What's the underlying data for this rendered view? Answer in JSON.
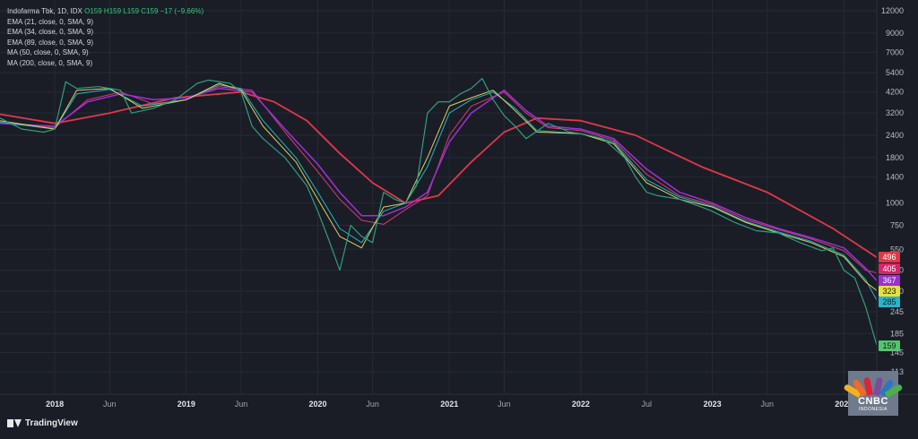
{
  "legend": {
    "ticker": "Indofarma Tbk, 1D, IDX",
    "ohlc": "O159 H159 L159 C159 −17 (−9.66%)",
    "lines": [
      "EMA (21, close, 0, SMA, 9)",
      "EMA (34, close, 0, SMA, 9)",
      "EMA (89, close, 0, SMA, 9)",
      "MA (50, close, 0, SMA, 9)",
      "MA (200, close, 0, SMA, 9)"
    ]
  },
  "branding": {
    "platform": "TradingView",
    "broadcaster": "CNBC",
    "broadcaster_sub": "INDONESIA"
  },
  "colors": {
    "background": "#1a1d26",
    "grid": "#262a35",
    "price": "#2e9e82",
    "ema21": "#d8d25a",
    "ema34": "#25b6c8",
    "ema89": "#a030d6",
    "ma50": "#d63a7a",
    "ma200": "#e03848",
    "last": "#53c56c"
  },
  "chart_data": {
    "type": "line",
    "title": "Indofarma Tbk, 1D, IDX",
    "y_scale": "log",
    "ylim": [
      113,
      12000
    ],
    "y_ticks": [
      12000,
      9000,
      7000,
      5400,
      4200,
      3200,
      2400,
      1800,
      1400,
      1000,
      750,
      550,
      420,
      320,
      245,
      185,
      145,
      113
    ],
    "x_ticks": [
      "2018",
      "Jun",
      "2019",
      "Jun",
      "2020",
      "Jun",
      "2021",
      "Jun",
      "2022",
      "Jul",
      "2023",
      "Jun",
      "2024"
    ],
    "x_tick_dates": [
      "2018-01",
      "2018-06",
      "2019-01",
      "2019-06",
      "2020-01",
      "2020-06",
      "2021-01",
      "2021-06",
      "2022-01",
      "2022-07",
      "2023-01",
      "2023-06",
      "2024-01"
    ],
    "xlim": [
      "2017-08",
      "2024-04"
    ],
    "series": [
      {
        "key": "price",
        "x": [
          "2017-08",
          "2017-10",
          "2017-12",
          "2018-01",
          "2018-02",
          "2018-03",
          "2018-05",
          "2018-07",
          "2018-08",
          "2018-10",
          "2018-12",
          "2019-02",
          "2019-03",
          "2019-05",
          "2019-06",
          "2019-07",
          "2019-08",
          "2019-10",
          "2019-12",
          "2020-01",
          "2020-02",
          "2020-03",
          "2020-04",
          "2020-05",
          "2020-06",
          "2020-07",
          "2020-08",
          "2020-09",
          "2020-10",
          "2020-11",
          "2020-12",
          "2021-01",
          "2021-02",
          "2021-03",
          "2021-04",
          "2021-05",
          "2021-06",
          "2021-07",
          "2021-08",
          "2021-10",
          "2021-12",
          "2022-01",
          "2022-03",
          "2022-05",
          "2022-06",
          "2022-07",
          "2022-08",
          "2022-10",
          "2022-12",
          "2023-01",
          "2023-03",
          "2023-05",
          "2023-07",
          "2023-09",
          "2023-11",
          "2023-12",
          "2024-01",
          "2024-02",
          "2024-03",
          "2024-04"
        ],
        "y": [
          3000,
          2600,
          2500,
          2600,
          4800,
          4400,
          4500,
          4300,
          3200,
          3400,
          3800,
          4700,
          4900,
          4700,
          4200,
          2700,
          2300,
          1800,
          1250,
          900,
          620,
          420,
          750,
          650,
          600,
          1150,
          1050,
          1000,
          1250,
          3200,
          3700,
          3700,
          4100,
          4400,
          5000,
          3800,
          3100,
          2700,
          2300,
          2800,
          2500,
          2450,
          2300,
          1800,
          1400,
          1150,
          1100,
          1050,
          950,
          900,
          780,
          700,
          680,
          600,
          540,
          560,
          420,
          380,
          260,
          159
        ]
      },
      {
        "key": "ema21",
        "x": [
          "2017-08",
          "2018-01",
          "2018-03",
          "2018-06",
          "2018-09",
          "2019-01",
          "2019-04",
          "2019-06",
          "2019-08",
          "2019-11",
          "2020-01",
          "2020-03",
          "2020-05",
          "2020-07",
          "2020-09",
          "2020-11",
          "2021-01",
          "2021-03",
          "2021-05",
          "2021-07",
          "2021-09",
          "2022-01",
          "2022-04",
          "2022-07",
          "2022-10",
          "2023-01",
          "2023-04",
          "2023-07",
          "2023-10",
          "2024-01",
          "2024-03",
          "2024-04"
        ],
        "y": [
          2900,
          2600,
          4300,
          4400,
          3400,
          3800,
          4700,
          4300,
          2700,
          1700,
          1050,
          650,
          560,
          950,
          1000,
          1800,
          3500,
          3900,
          4300,
          3300,
          2500,
          2450,
          2150,
          1300,
          1050,
          950,
          780,
          680,
          600,
          500,
          360,
          323
        ]
      },
      {
        "key": "ema34",
        "x": [
          "2017-08",
          "2018-01",
          "2018-03",
          "2018-06",
          "2018-09",
          "2019-01",
          "2019-04",
          "2019-06",
          "2019-08",
          "2019-11",
          "2020-01",
          "2020-03",
          "2020-05",
          "2020-07",
          "2020-09",
          "2020-11",
          "2021-01",
          "2021-03",
          "2021-05",
          "2021-07",
          "2021-09",
          "2022-01",
          "2022-04",
          "2022-07",
          "2022-10",
          "2023-01",
          "2023-04",
          "2023-07",
          "2023-10",
          "2024-01",
          "2024-03",
          "2024-04"
        ],
        "y": [
          2850,
          2600,
          4100,
          4350,
          3500,
          3800,
          4600,
          4400,
          2900,
          1800,
          1150,
          720,
          600,
          900,
          1000,
          1600,
          3200,
          3800,
          4200,
          3400,
          2550,
          2450,
          2200,
          1350,
          1080,
          960,
          790,
          690,
          610,
          510,
          370,
          285
        ]
      },
      {
        "key": "ema89",
        "x": [
          "2017-08",
          "2018-01",
          "2018-04",
          "2018-07",
          "2018-10",
          "2019-01",
          "2019-04",
          "2019-07",
          "2019-10",
          "2020-01",
          "2020-03",
          "2020-05",
          "2020-07",
          "2020-09",
          "2020-11",
          "2021-01",
          "2021-03",
          "2021-06",
          "2021-08",
          "2021-10",
          "2022-01",
          "2022-04",
          "2022-07",
          "2022-10",
          "2023-01",
          "2023-04",
          "2023-07",
          "2023-10",
          "2024-01",
          "2024-03",
          "2024-04"
        ],
        "y": [
          2800,
          2700,
          3700,
          4100,
          3800,
          3900,
          4400,
          4200,
          2600,
          1650,
          1150,
          850,
          850,
          950,
          1150,
          2200,
          3200,
          4300,
          3300,
          2700,
          2600,
          2300,
          1550,
          1150,
          1000,
          830,
          720,
          640,
          560,
          430,
          367
        ]
      },
      {
        "key": "ma50",
        "x": [
          "2017-08",
          "2018-01",
          "2018-04",
          "2018-07",
          "2018-10",
          "2019-01",
          "2019-04",
          "2019-07",
          "2019-10",
          "2020-01",
          "2020-03",
          "2020-05",
          "2020-07",
          "2020-09",
          "2020-11",
          "2021-01",
          "2021-03",
          "2021-06",
          "2021-08",
          "2021-10",
          "2022-01",
          "2022-04",
          "2022-07",
          "2022-10",
          "2023-01",
          "2023-04",
          "2023-07",
          "2023-10",
          "2024-01",
          "2024-03",
          "2024-04"
        ],
        "y": [
          2800,
          2650,
          3800,
          4200,
          3600,
          3800,
          4500,
          4300,
          2500,
          1500,
          1050,
          800,
          760,
          920,
          1100,
          2400,
          3500,
          4200,
          3200,
          2650,
          2550,
          2250,
          1450,
          1100,
          980,
          810,
          710,
          630,
          540,
          420,
          405
        ]
      },
      {
        "key": "ma200",
        "x": [
          "2017-08",
          "2018-01",
          "2018-06",
          "2018-12",
          "2019-06",
          "2019-09",
          "2019-12",
          "2020-03",
          "2020-06",
          "2020-09",
          "2020-12",
          "2021-03",
          "2021-06",
          "2021-09",
          "2022-01",
          "2022-06",
          "2022-12",
          "2023-06",
          "2023-12",
          "2024-04"
        ],
        "y": [
          3150,
          2800,
          3200,
          3900,
          4200,
          3700,
          2900,
          1900,
          1300,
          1000,
          1100,
          1700,
          2500,
          3000,
          2900,
          2400,
          1600,
          1150,
          720,
          496
        ]
      }
    ],
    "last_value_labels": [
      {
        "value": "496",
        "series": "ma200"
      },
      {
        "value": "405",
        "series": "ma50"
      },
      {
        "value": "367",
        "series": "ema89"
      },
      {
        "value": "323",
        "series": "ema21"
      },
      {
        "value": "285",
        "series": "ema34"
      },
      {
        "value": "159",
        "series": "price"
      }
    ]
  }
}
